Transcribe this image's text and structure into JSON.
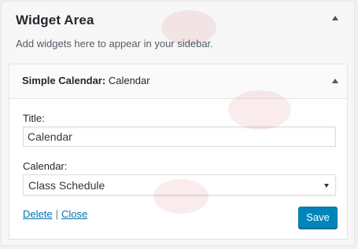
{
  "panel": {
    "title": "Widget Area",
    "description": "Add widgets here to appear in your sidebar."
  },
  "widget": {
    "name": "Simple Calendar",
    "instance_title": "Calendar",
    "fields": {
      "title_label": "Title:",
      "title_value": "Calendar",
      "calendar_label": "Calendar:",
      "calendar_selected": "Class Schedule"
    },
    "actions": {
      "delete_label": "Delete",
      "separator": "|",
      "close_label": "Close",
      "save_label": "Save"
    }
  },
  "colors": {
    "link": "#0073aa",
    "primary_button": "#0085ba",
    "watermark": "#c00000"
  },
  "icons": {
    "panel_toggle": "arrow-up-icon",
    "widget_toggle": "arrow-up-icon",
    "select_dropdown": "chevron-down-icon"
  }
}
